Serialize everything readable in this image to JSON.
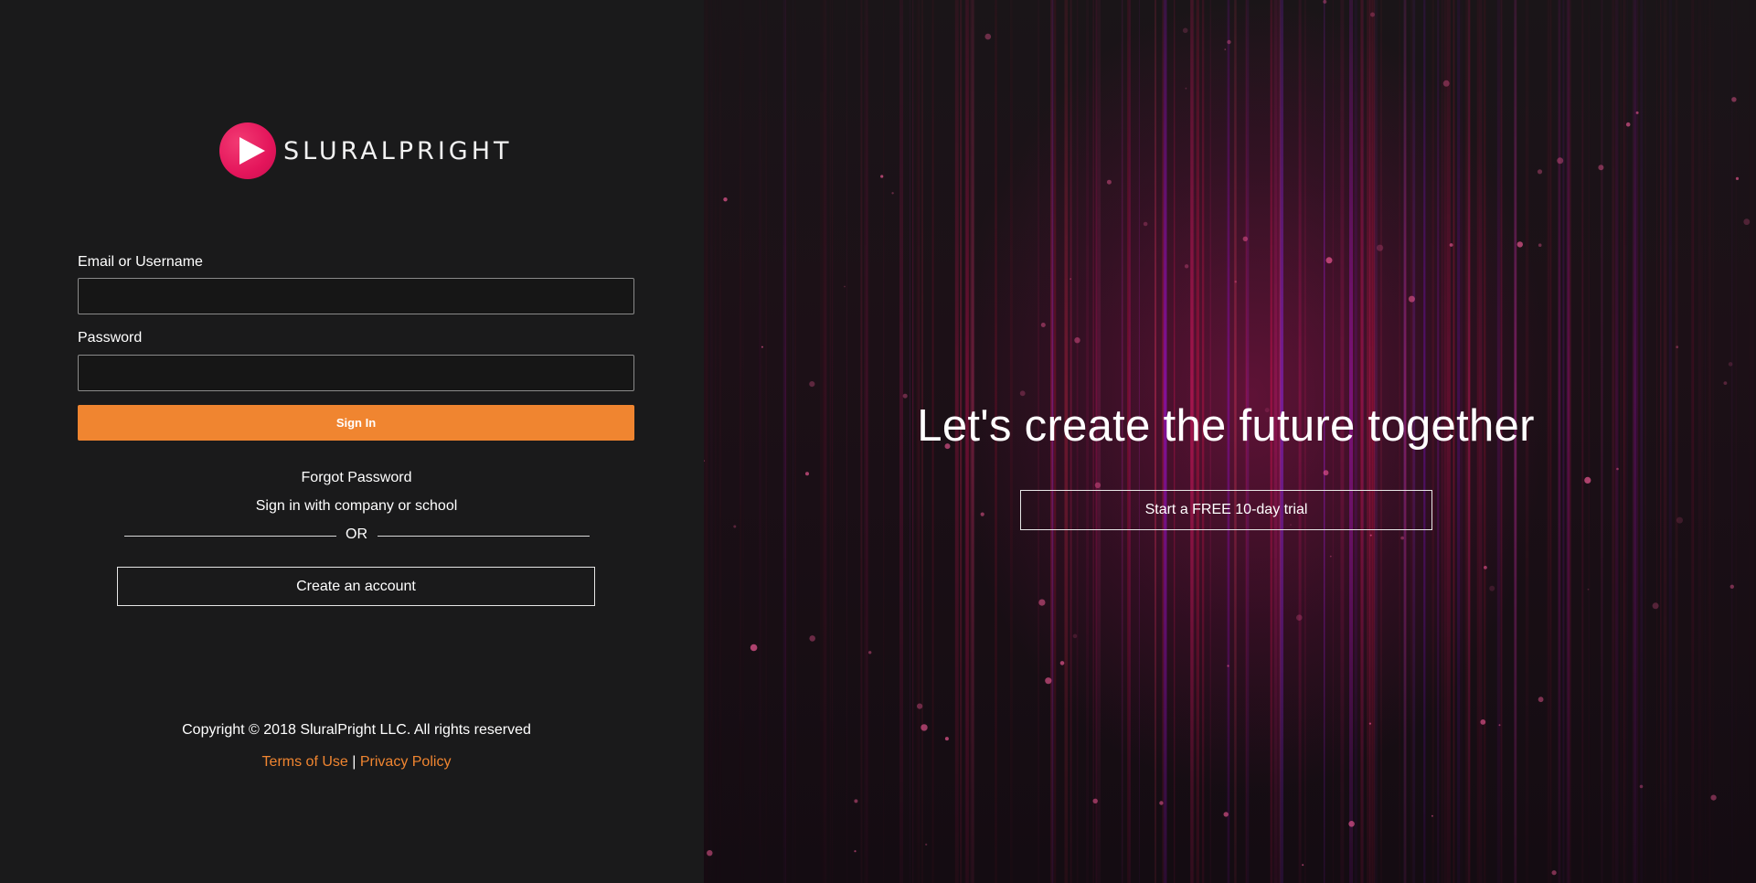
{
  "brand": {
    "name": "SLURALPRIGHT",
    "logo_icon": "play-icon",
    "accent_color": "#f08530",
    "logo_color": "#e4155b"
  },
  "login_form": {
    "username_label": "Email or Username",
    "username_value": "",
    "password_label": "Password",
    "password_value": "",
    "signin_label": "Sign In"
  },
  "links": {
    "forgot_password": "Forgot Password",
    "company_signin": "Sign in with company or school",
    "or_text": "OR",
    "create_account": "Create an account"
  },
  "footer": {
    "copyright": "Copyright © 2018 SluralPright LLC. All rights reserved",
    "terms": "Terms of Use",
    "separator": "|",
    "privacy": "Privacy Policy"
  },
  "hero": {
    "title": "Let's create the future together",
    "trial_button": "Start a FREE 10-day trial"
  }
}
